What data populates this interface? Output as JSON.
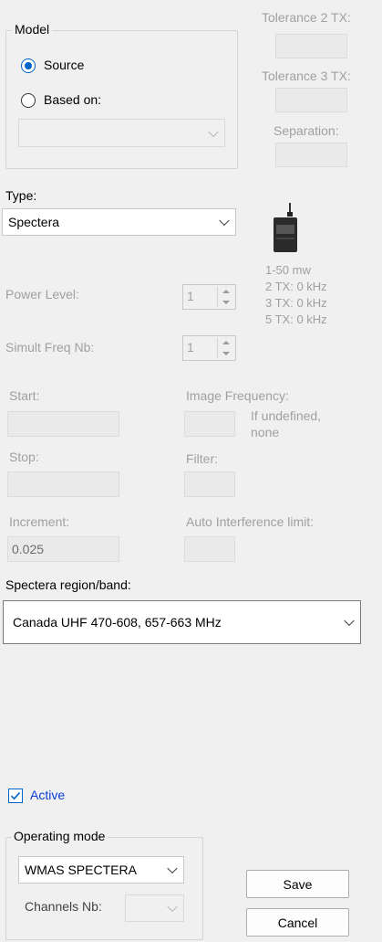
{
  "model": {
    "group_title": "Model",
    "source_label": "Source",
    "based_on_label": "Based on:",
    "based_on_value": ""
  },
  "tolerance": {
    "tol2_label": "Tolerance 2 TX:",
    "tol3_label": "Tolerance 3 TX:",
    "separation_label": "Separation:"
  },
  "type": {
    "label": "Type:",
    "value": "Spectera"
  },
  "device_info": {
    "icon": "bodypack-transmitter-icon",
    "range": "1-50 mw",
    "tx2": "2 TX: 0 kHz",
    "tx3": "3 TX: 0 kHz",
    "tx5": "5 TX: 0 kHz"
  },
  "power": {
    "label": "Power Level:",
    "value": "1"
  },
  "simult": {
    "label": "Simult Freq Nb:",
    "value": "1"
  },
  "start": {
    "label": "Start:",
    "value": ""
  },
  "image_frequency": {
    "label": "Image Frequency:",
    "note": "If undefined, none"
  },
  "stop": {
    "label": "Stop:",
    "value": ""
  },
  "filter": {
    "label": "Filter:"
  },
  "increment": {
    "label": "Increment:",
    "value": "0.025"
  },
  "auto_interference": {
    "label": "Auto Interference limit:"
  },
  "region": {
    "label": "Spectera region/band:",
    "value": "Canada UHF 470-608, 657-663 MHz"
  },
  "active": {
    "label": "Active",
    "checked": true
  },
  "operating": {
    "group_title": "Operating mode",
    "mode_value": "WMAS SPECTERA",
    "channels_label": "Channels Nb:",
    "channels_value": ""
  },
  "buttons": {
    "save": "Save",
    "cancel": "Cancel"
  },
  "colors": {
    "accent": "#0064c8",
    "disabled_text": "#a0a0a0"
  }
}
